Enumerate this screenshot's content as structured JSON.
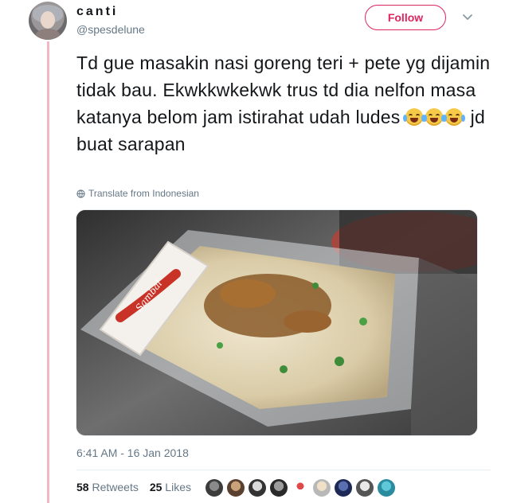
{
  "user": {
    "name": "canti",
    "handle": "@spesdelune"
  },
  "follow_button": {
    "label": "Follow"
  },
  "tweet": {
    "text_parts": [
      "Td gue masakin nasi goreng teri + pete yg dijamin tidak bau. Ekwkkwkekwk trus td dia nelfon masa katanya belom jam istirahat udah ludes ",
      " jd buat sarapan"
    ],
    "emojis": [
      "face-with-tears-of-joy",
      "face-with-tears-of-joy",
      "face-with-tears-of-joy"
    ],
    "translate_label": "Translate from Indonesian",
    "timestamp": "6:41 AM - 16 Jan 2018"
  },
  "stats": {
    "retweets_count": "58",
    "retweets_label": "Retweets",
    "likes_count": "25",
    "likes_label": "Likes"
  },
  "colors": {
    "accent": "#e0245e",
    "thread_line": "#f1b7c6",
    "muted_text": "#657786"
  }
}
